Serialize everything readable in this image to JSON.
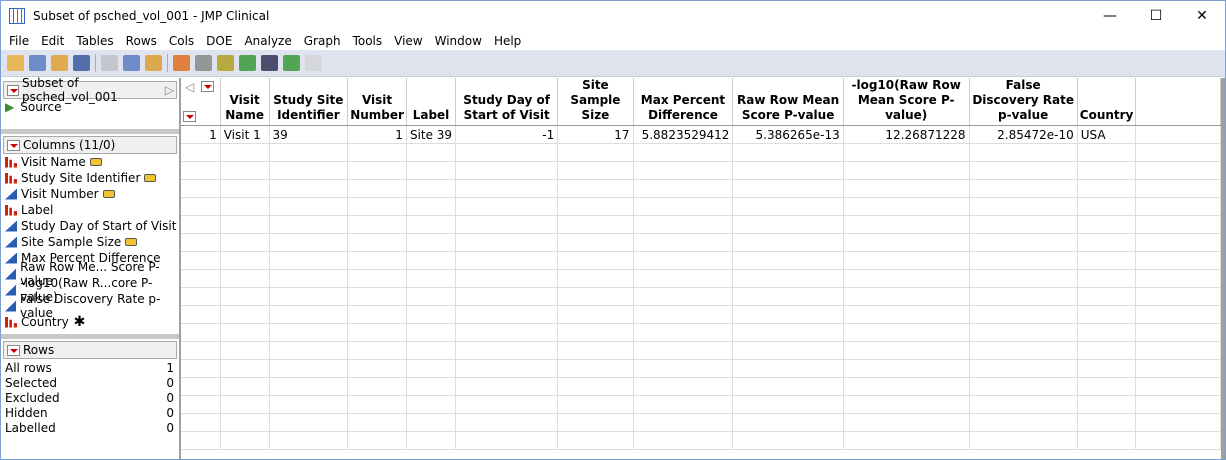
{
  "window": {
    "title": "Subset of psched_vol_001 - JMP Clinical",
    "minimize": "—",
    "maximize": "☐",
    "close": "✕"
  },
  "menu": [
    "File",
    "Edit",
    "Tables",
    "Rows",
    "Cols",
    "DOE",
    "Analyze",
    "Graph",
    "Tools",
    "View",
    "Window",
    "Help"
  ],
  "toolbar": {
    "icons": [
      "new-data-table-icon",
      "new-script-icon",
      "open-icon",
      "save-icon",
      "cut-icon",
      "copy-icon",
      "paste-icon",
      "data-table-icon",
      "tabulate-icon",
      "grid-icon",
      "distribution-icon",
      "fit-y-by-x-icon",
      "fit-model-icon",
      "edit-icon"
    ]
  },
  "table_panel": {
    "name": "Subset of psched_vol_001",
    "source": "Source"
  },
  "columns_panel": {
    "header": "Columns (11/0)",
    "items": [
      {
        "label": "Visit Name",
        "type": "nominal",
        "tag": true
      },
      {
        "label": "Study Site Identifier",
        "type": "nominal",
        "tag": true
      },
      {
        "label": "Visit Number",
        "type": "continuous",
        "tag": true
      },
      {
        "label": "Label",
        "type": "nominal",
        "tag": false
      },
      {
        "label": "Study Day of Start of Visit",
        "type": "continuous",
        "tag": false
      },
      {
        "label": "Site Sample Size",
        "type": "continuous",
        "tag": true
      },
      {
        "label": "Max Percent Difference",
        "type": "continuous",
        "tag": false
      },
      {
        "label": "Raw Row Me... Score P-value",
        "type": "continuous",
        "tag": false
      },
      {
        "label": "-log10(Raw R...core P-value)",
        "type": "continuous",
        "tag": false
      },
      {
        "label": "False Discovery Rate p-value",
        "type": "continuous",
        "tag": false
      },
      {
        "label": "Country",
        "type": "nominal",
        "tag": false,
        "marker": "✱"
      }
    ]
  },
  "rows_panel": {
    "header": "Rows",
    "stats": [
      {
        "label": "All rows",
        "value": "1"
      },
      {
        "label": "Selected",
        "value": "0"
      },
      {
        "label": "Excluded",
        "value": "0"
      },
      {
        "label": "Hidden",
        "value": "0"
      },
      {
        "label": "Labelled",
        "value": "0"
      }
    ]
  },
  "grid": {
    "headers": [
      "Visit Name",
      "Study Site Identifier",
      "Visit Number",
      "Label",
      "Study Day of Start of Visit",
      "Site Sample Size",
      "Max Percent Difference",
      "Raw Row Mean Score P-value",
      "-log10(Raw Row Mean Score P-value)",
      "False Discovery Rate p-value",
      "Country"
    ],
    "rows": [
      {
        "num": "1",
        "cells": [
          "Visit 1",
          "39",
          "1",
          "Site 39",
          "-1",
          "17",
          "5.8823529412",
          "5.386265e-13",
          "12.26871228",
          "2.85472e-10",
          "USA"
        ]
      }
    ]
  }
}
